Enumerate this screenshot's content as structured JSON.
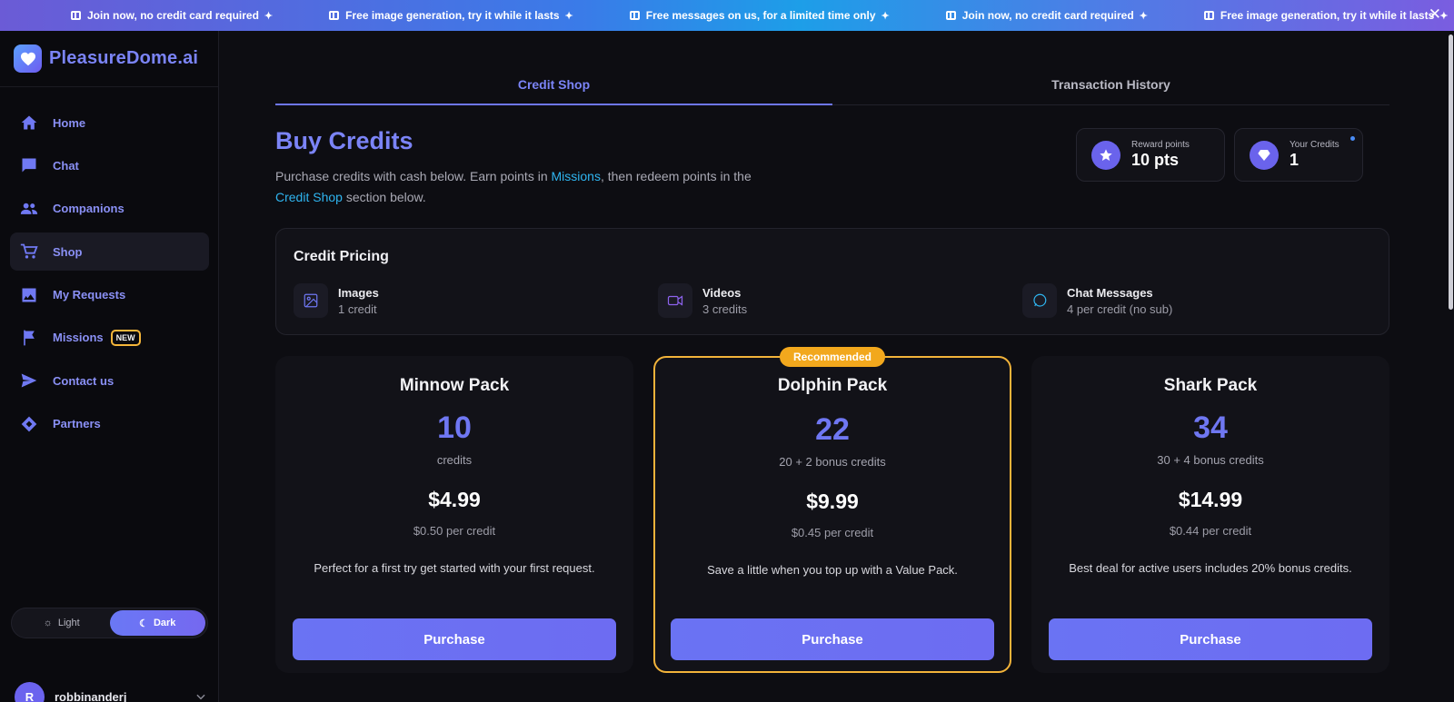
{
  "topbar": {
    "messages": [
      "Join now, no credit card required",
      "Free image generation, try it while it lasts",
      "Free messages on us, for a limited time only",
      "Join now, no credit card required",
      "Free image generation, try it while it lasts"
    ],
    "close_icon": "close-icon"
  },
  "brand": {
    "name": "PleasureDome.ai",
    "icon": "heart-icon"
  },
  "sidebar": {
    "items": [
      {
        "label": "Home",
        "icon": "home-icon"
      },
      {
        "label": "Chat",
        "icon": "chat-bubble-icon"
      },
      {
        "label": "Companions",
        "icon": "people-icon"
      },
      {
        "label": "Shop",
        "icon": "cart-icon",
        "active": true
      },
      {
        "label": "My Requests",
        "icon": "image-icon"
      },
      {
        "label": "Missions",
        "icon": "flag-icon",
        "badge": "NEW"
      },
      {
        "label": "Contact us",
        "icon": "send-icon"
      },
      {
        "label": "Partners",
        "icon": "handshake-icon"
      }
    ],
    "theme": {
      "light_label": "Light",
      "dark_label": "Dark",
      "selected": "Dark"
    },
    "user": {
      "initial": "R",
      "name": "robbinanderj"
    }
  },
  "tabs": [
    {
      "label": "Credit Shop",
      "active": true
    },
    {
      "label": "Transaction History",
      "active": false
    }
  ],
  "header": {
    "title": "Buy Credits",
    "subtitle_1": "Purchase credits with cash below. Earn points in ",
    "link_missions": "Missions",
    "subtitle_2": ", then redeem points in the ",
    "link_shop": "Credit Shop",
    "subtitle_3": " section below."
  },
  "stats": {
    "reward": {
      "label": "Reward points",
      "value": "10 pts",
      "icon": "star-icon"
    },
    "credits": {
      "label": "Your Credits",
      "value": "1",
      "icon": "gem-icon"
    }
  },
  "pricing": {
    "title": "Credit Pricing",
    "items": [
      {
        "name": "Images",
        "cost": "1 credit",
        "icon": "image-icon"
      },
      {
        "name": "Videos",
        "cost": "3 credits",
        "icon": "video-icon"
      },
      {
        "name": "Chat Messages",
        "cost": "4 per credit (no sub)",
        "icon": "message-icon"
      }
    ]
  },
  "packs": [
    {
      "name": "Minnow Pack",
      "credits": "10",
      "credits_sub": "credits",
      "price": "$4.99",
      "per": "$0.50 per credit",
      "desc": "Perfect for a first try get started with your first request.",
      "button": "Purchase"
    },
    {
      "name": "Dolphin Pack",
      "credits": "22",
      "credits_sub": "20 + 2 bonus credits",
      "price": "$9.99",
      "per": "$0.45 per credit",
      "desc": "Save a little when you top up with a Value Pack.",
      "button": "Purchase",
      "badge": "Recommended"
    },
    {
      "name": "Shark Pack",
      "credits": "34",
      "credits_sub": "30 + 4 bonus credits",
      "price": "$14.99",
      "per": "$0.44 per credit",
      "desc": "Best deal for active users includes 20% bonus credits.",
      "button": "Purchase"
    }
  ],
  "colors": {
    "accent": "#6f77f2",
    "link": "#2fb5f0",
    "badge": "#f2a81d"
  }
}
